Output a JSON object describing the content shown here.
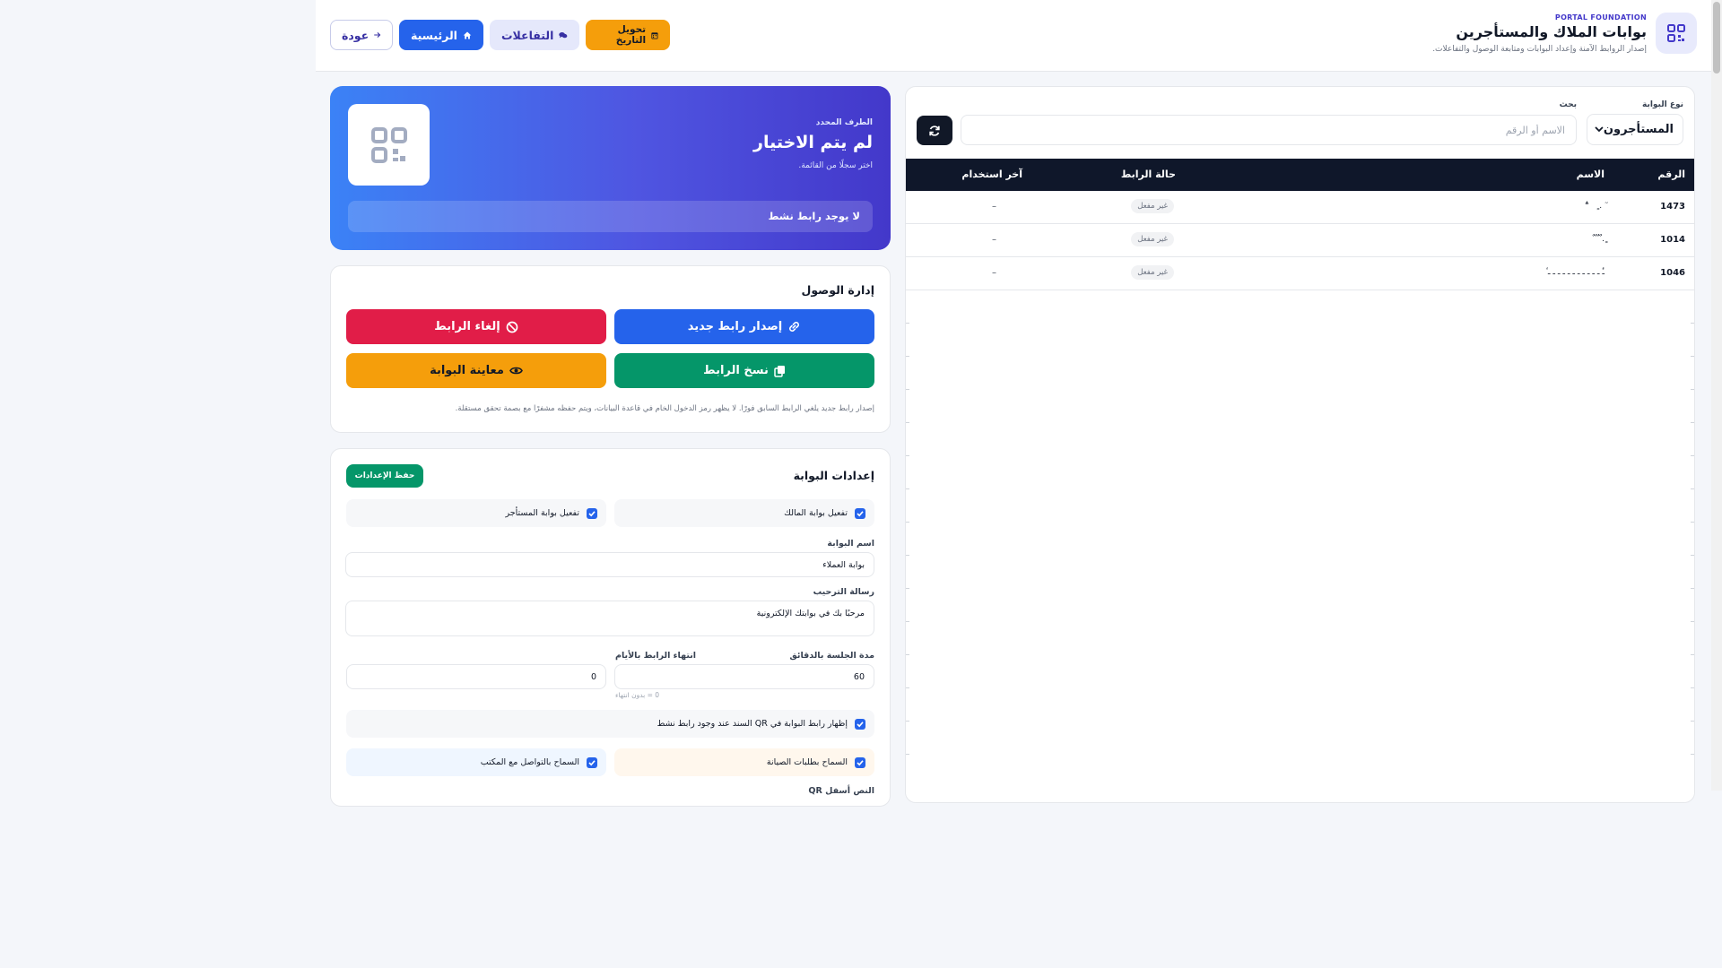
{
  "header": {
    "eyebrow": "PORTAL FOUNDATION",
    "title": "بوابات الملاك والمستأجرين",
    "subtitle": "إصدار الروابط الآمنة وإعداد البوابات ومتابعة الوصول والتفاعلات.",
    "nav": {
      "back": "عودة",
      "home": "الرئيسية",
      "interactions": "التفاعلات",
      "date_convert": "تحويل التاريخ"
    }
  },
  "filters": {
    "type_label": "نوع البوابة",
    "type_value": "المستأجرون",
    "search_label": "بحث",
    "search_placeholder": "الاسم أو الرقم"
  },
  "table": {
    "columns": {
      "num": "الرقم",
      "name": "الاسم",
      "status": "حالة الرابط",
      "last_used": "آخر استخدام"
    },
    "rows": [
      {
        "num": "1473",
        "name": "ٓ . ٍ   ؞",
        "status": "غير مفعل",
        "last_used": "–"
      },
      {
        "num": "1014",
        "name": "ٍ. ٌ ٌ ٌ ٌ",
        "status": "غير مفعل",
        "last_used": "–"
      },
      {
        "num": "1046",
        "name": "ـٔٔ ـ ـ ـ ـ ـ ـ ـ ـ ـ ـ ـ ٔ",
        "status": "غير مفعل",
        "last_used": "–"
      }
    ]
  },
  "selected": {
    "eyebrow": "الطرف المحدد",
    "title": "لم يتم الاختيار",
    "subtitle": "اختر سجلًا من القائمة.",
    "link_status": "لا يوجد رابط نشط"
  },
  "access": {
    "title": "إدارة الوصول",
    "issue": "إصدار رابط جديد",
    "revoke": "إلغاء الرابط",
    "copy": "نسخ الرابط",
    "preview": "معاينة البوابة",
    "note": "إصدار رابط جديد يلغي الرابط السابق فورًا. لا يظهر رمز الدخول الخام في قاعدة البيانات، ويتم حفظه مشفرًا مع بصمة تحقق مستقلة."
  },
  "settings": {
    "title": "إعدادات البوابة",
    "save": "حفظ الإعدادات",
    "owner_enable": "تفعيل بوابة المالك",
    "tenant_enable": "تفعيل بوابة المستأجر",
    "portal_name_label": "اسم البوابة",
    "portal_name_value": "بوابة العملاء",
    "welcome_label": "رسالة الترحيب",
    "welcome_value": "مرحبًا بك في بوابتك الإلكترونية",
    "session_label": "مدة الجلسة بالدقائق",
    "session_value": "60",
    "expiry_label": "انتهاء الرابط بالأيام",
    "expiry_value": "0",
    "expiry_hint": "0 = بدون انتهاء",
    "qr_option": "إظهار رابط البوابة في QR السند عند وجود رابط نشط",
    "maintenance": "السماح بطلبات الصيانة",
    "contact": "السماح بالتواصل مع المكتب",
    "next_label": "النص أسفل QR"
  },
  "colors": {
    "primary": "#2563eb",
    "indigo": "#4338ca",
    "danger": "#e11d48",
    "success": "#059669",
    "warning": "#f59e0b",
    "dark": "#0f172a"
  },
  "icons": {
    "brand": "qr-icon",
    "back": "arrow-right-icon",
    "home": "home-icon",
    "interactions": "chat-icon",
    "date": "calendar-icon",
    "refresh": "refresh-icon",
    "issue": "link-icon",
    "revoke": "ban-icon",
    "copy": "copy-icon",
    "preview": "eye-icon"
  }
}
